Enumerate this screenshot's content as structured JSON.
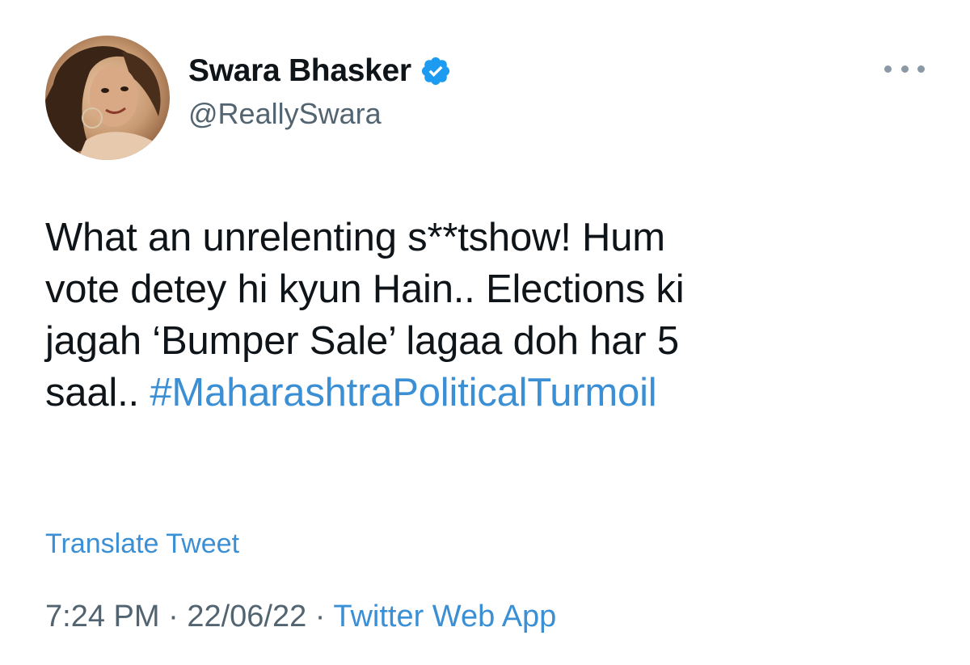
{
  "author": {
    "name": "Swara Bhasker",
    "handle": "@ReallySwara",
    "verified": true,
    "avatar_icon": "profile-photo"
  },
  "tweet": {
    "lines": [
      "What an unrelenting s**tshow! Hum",
      "vote detey hi kyun Hain.. Elections ki",
      "jagah ‘Bumper Sale’ lagaa doh har 5",
      "saal.. "
    ],
    "hashtag": "#MaharashtraPoliticalTurmoil",
    "translate_label": "Translate Tweet"
  },
  "meta": {
    "time": "7:24 PM",
    "separator": " · ",
    "date": "22/06/22",
    "source": "Twitter Web App"
  },
  "icons": {
    "more": "more-options-icon",
    "verified": "verified-badge-icon"
  },
  "colors": {
    "link": "#3b8fd4",
    "verified_badge": "#1d9bf0",
    "text": "#0f1419",
    "secondary": "#536471"
  }
}
